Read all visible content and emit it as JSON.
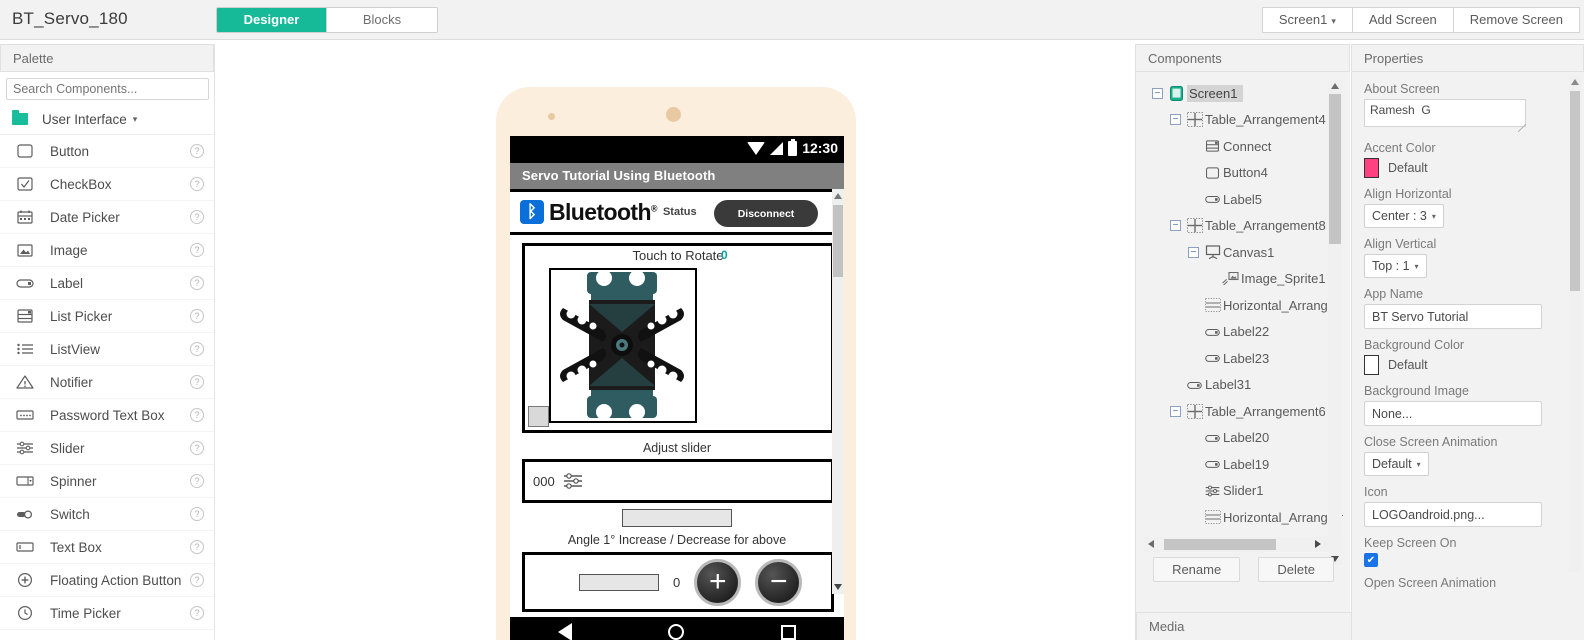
{
  "topbar": {
    "project_title": "BT_Servo_180",
    "modes": [
      {
        "label": "Designer",
        "active": true
      },
      {
        "label": "Blocks",
        "active": false
      }
    ],
    "screen_selector": "Screen1",
    "add_screen": "Add Screen",
    "remove_screen": "Remove Screen"
  },
  "palette": {
    "header": "Palette",
    "search_placeholder": "Search Components...",
    "category": "User Interface",
    "items": [
      {
        "label": "Button",
        "icon": "button-icon",
        "help": "?"
      },
      {
        "label": "CheckBox",
        "icon": "checkbox-icon",
        "help": "?"
      },
      {
        "label": "Date Picker",
        "icon": "date-picker-icon",
        "help": "?"
      },
      {
        "label": "Image",
        "icon": "image-icon",
        "help": "?"
      },
      {
        "label": "Label",
        "icon": "label-icon",
        "help": "?"
      },
      {
        "label": "List Picker",
        "icon": "list-picker-icon",
        "help": "?"
      },
      {
        "label": "ListView",
        "icon": "listview-icon",
        "help": "?"
      },
      {
        "label": "Notifier",
        "icon": "notifier-icon",
        "help": "?"
      },
      {
        "label": "Password Text Box",
        "icon": "password-textbox-icon",
        "help": "?"
      },
      {
        "label": "Slider",
        "icon": "slider-icon",
        "help": "?"
      },
      {
        "label": "Spinner",
        "icon": "spinner-icon",
        "help": "?"
      },
      {
        "label": "Switch",
        "icon": "switch-icon",
        "help": "?"
      },
      {
        "label": "Text Box",
        "icon": "textbox-icon",
        "help": "?"
      },
      {
        "label": "Floating Action Button",
        "icon": "floating-action-button-icon",
        "help": "?"
      },
      {
        "label": "Time Picker",
        "icon": "time-picker-icon",
        "help": "?"
      }
    ]
  },
  "phone_preview": {
    "status_time": "12:30",
    "app_title": "Servo Tutorial Using Bluetooth",
    "bluetooth_word": "Bluetooth",
    "bluetooth_reg": "®",
    "bluetooth_status": "Status",
    "disconnect_button": "Disconnect",
    "canvas_title": "Touch to Rotate",
    "canvas_angle_value": "0",
    "adjust_slider_label": "Adjust slider",
    "slider_value": "000",
    "angle_label": "Angle 1° Increase / Decrease for above",
    "counter_value": "0",
    "plus_button": "+",
    "minus_button": "−"
  },
  "components": {
    "header": "Components",
    "tree": [
      {
        "label": "Screen1",
        "depth": 0,
        "expander": "−",
        "icon": "screen-icon",
        "selected": true
      },
      {
        "label": "Table_Arrangement4",
        "depth": 1,
        "expander": "−",
        "icon": "table-arrangement-icon",
        "selected": false
      },
      {
        "label": "Connect",
        "depth": 2,
        "expander": "",
        "icon": "list-picker-icon",
        "selected": false
      },
      {
        "label": "Button4",
        "depth": 2,
        "expander": "",
        "icon": "button-icon",
        "selected": false
      },
      {
        "label": "Label5",
        "depth": 2,
        "expander": "",
        "icon": "label-icon",
        "selected": false
      },
      {
        "label": "Table_Arrangement8",
        "depth": 1,
        "expander": "−",
        "icon": "table-arrangement-icon",
        "selected": false
      },
      {
        "label": "Canvas1",
        "depth": 2,
        "expander": "−",
        "icon": "canvas-icon",
        "selected": false
      },
      {
        "label": "Image_Sprite1",
        "depth": 3,
        "expander": "",
        "icon": "image-sprite-icon",
        "selected": false
      },
      {
        "label": "Horizontal_Arrang",
        "depth": 2,
        "expander": "",
        "icon": "horizontal-arrangement-icon",
        "selected": false
      },
      {
        "label": "Label22",
        "depth": 2,
        "expander": "",
        "icon": "label-icon",
        "selected": false
      },
      {
        "label": "Label23",
        "depth": 2,
        "expander": "",
        "icon": "label-icon",
        "selected": false
      },
      {
        "label": "Label31",
        "depth": 1,
        "expander": "",
        "icon": "label-icon",
        "selected": false
      },
      {
        "label": "Table_Arrangement6",
        "depth": 1,
        "expander": "−",
        "icon": "table-arrangement-icon",
        "selected": false
      },
      {
        "label": "Label20",
        "depth": 2,
        "expander": "",
        "icon": "label-icon",
        "selected": false
      },
      {
        "label": "Label19",
        "depth": 2,
        "expander": "",
        "icon": "label-icon",
        "selected": false
      },
      {
        "label": "Slider1",
        "depth": 2,
        "expander": "",
        "icon": "slider-icon",
        "selected": false
      },
      {
        "label": "Horizontal_Arrangem",
        "depth": 2,
        "expander": "",
        "icon": "horizontal-arrangement-icon",
        "selected": false
      }
    ],
    "rename_button": "Rename",
    "delete_button": "Delete",
    "media_header": "Media"
  },
  "properties": {
    "header": "Properties",
    "about_screen_label": "About Screen",
    "about_screen_value": "Ramesh  G",
    "accent_color_label": "Accent Color",
    "accent_color_value": "Default",
    "accent_color_hex": "#ff4081",
    "align_horizontal_label": "Align Horizontal",
    "align_horizontal_value": "Center : 3",
    "align_vertical_label": "Align Vertical",
    "align_vertical_value": "Top : 1",
    "app_name_label": "App Name",
    "app_name_value": "BT Servo Tutorial",
    "background_color_label": "Background Color",
    "background_color_value": "Default",
    "background_color_hex": "#ffffff",
    "background_image_label": "Background Image",
    "background_image_value": "None...",
    "close_screen_animation_label": "Close Screen Animation",
    "close_screen_animation_value": "Default",
    "icon_label": "Icon",
    "icon_value": "LOGOandroid.png...",
    "keep_screen_on_label": "Keep Screen On",
    "keep_screen_on_checked": "✔",
    "open_screen_animation_label": "Open Screen Animation"
  }
}
